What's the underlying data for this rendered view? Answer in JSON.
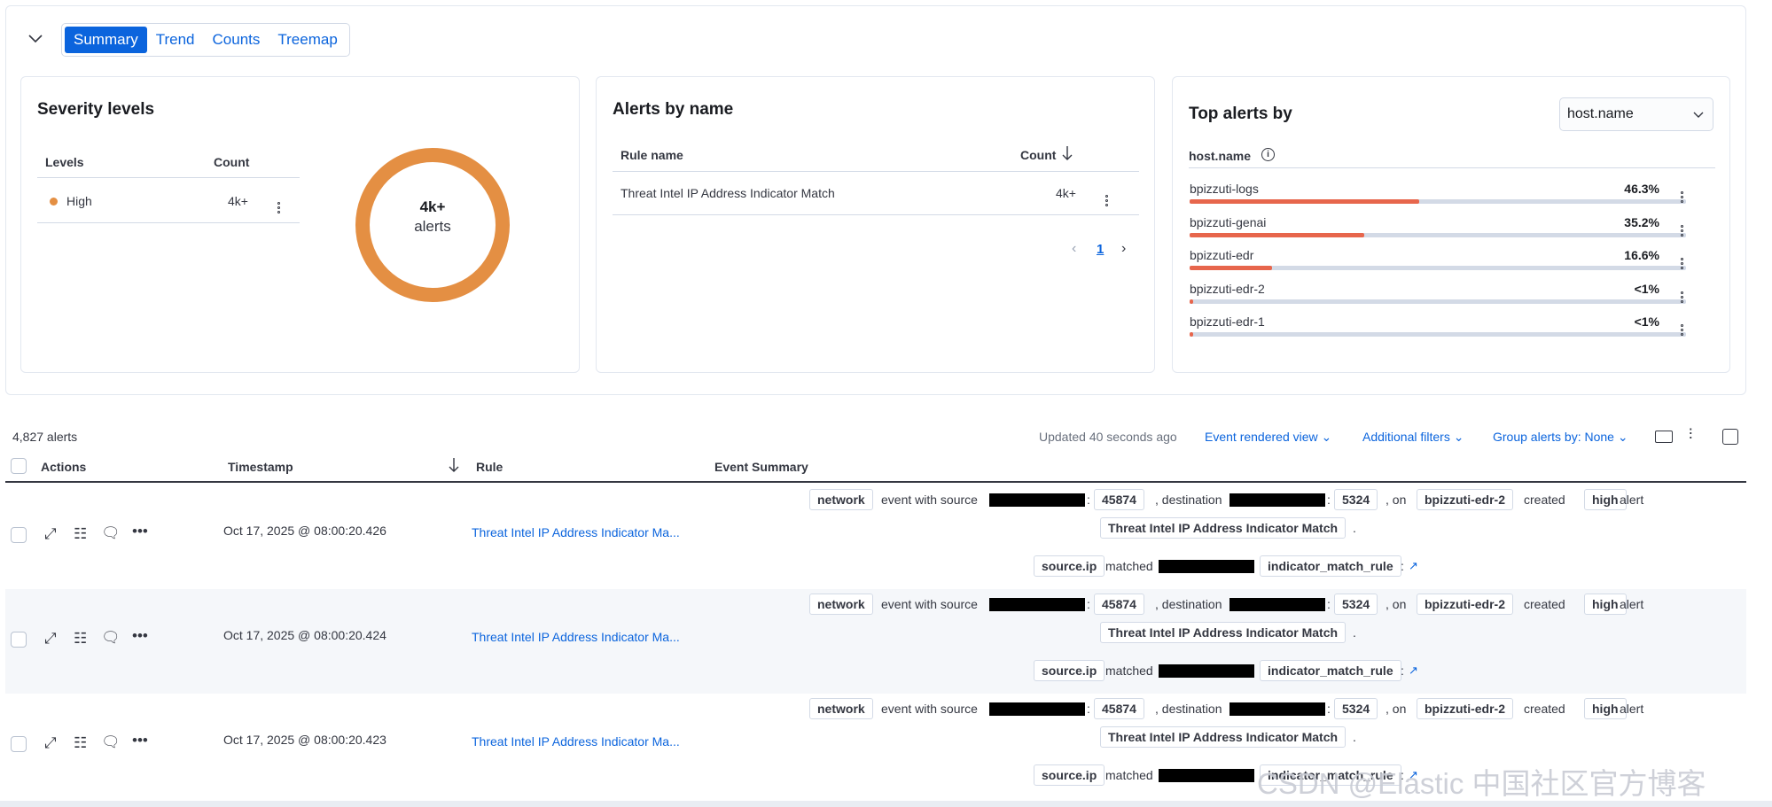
{
  "tabs": [
    "Summary",
    "Trend",
    "Counts",
    "Treemap"
  ],
  "severity": {
    "title": "Severity levels",
    "col_levels": "Levels",
    "col_count": "Count",
    "row_level": "High",
    "row_count": "4k+",
    "donut_value": "4k+",
    "donut_label": "alerts",
    "color": "#e48f43"
  },
  "alerts_by_name": {
    "title": "Alerts by name",
    "col_rule": "Rule name",
    "col_count": "Count",
    "row_rule": "Threat Intel IP Address Indicator Match",
    "row_count": "4k+",
    "page": "1"
  },
  "top_alerts": {
    "title": "Top alerts by",
    "select_value": "host.name",
    "field_label": "host.name",
    "items": [
      {
        "name": "bpizzuti-logs",
        "pct": "46.3%",
        "fill": 0.463
      },
      {
        "name": "bpizzuti-genai",
        "pct": "35.2%",
        "fill": 0.352
      },
      {
        "name": "bpizzuti-edr",
        "pct": "16.6%",
        "fill": 0.166
      },
      {
        "name": "bpizzuti-edr-2",
        "pct": "<1%",
        "fill": 0.004
      },
      {
        "name": "bpizzuti-edr-1",
        "pct": "<1%",
        "fill": 0.004
      }
    ]
  },
  "toolbar": {
    "count": "4,827 alerts",
    "updated": "Updated 40 seconds ago",
    "view": "Event rendered view",
    "filters": "Additional filters",
    "group": "Group alerts by: None"
  },
  "table": {
    "col_actions": "Actions",
    "col_timestamp": "Timestamp",
    "col_rule": "Rule",
    "col_summary": "Event Summary"
  },
  "rows": [
    {
      "timestamp": "Oct 17, 2025 @ 08:00:20.426",
      "rule": "Threat Intel IP Address Indicator Ma..."
    },
    {
      "timestamp": "Oct 17, 2025 @ 08:00:20.424",
      "rule": "Threat Intel IP Address Indicator Ma..."
    },
    {
      "timestamp": "Oct 17, 2025 @ 08:00:20.423",
      "rule": "Threat Intel IP Address Indicator Ma..."
    }
  ],
  "summary": {
    "network": "network",
    "event_with_source": "event with source",
    "colon": ":",
    "src_port": "45874",
    "destination": ", destination",
    "dst_port": "5324",
    "on": ", on",
    "host": "bpizzuti-edr-2",
    "created": "created",
    "severity": "high",
    "alert": "alert",
    "rule_badge": "Threat Intel IP Address Indicator Match",
    "period": ".",
    "source_ip": "source.ip",
    "matched": "matched",
    "indicator": "indicator_match_rule",
    "colon2": ":"
  },
  "watermark": "CSDN @Elastic 中国社区官方博客"
}
